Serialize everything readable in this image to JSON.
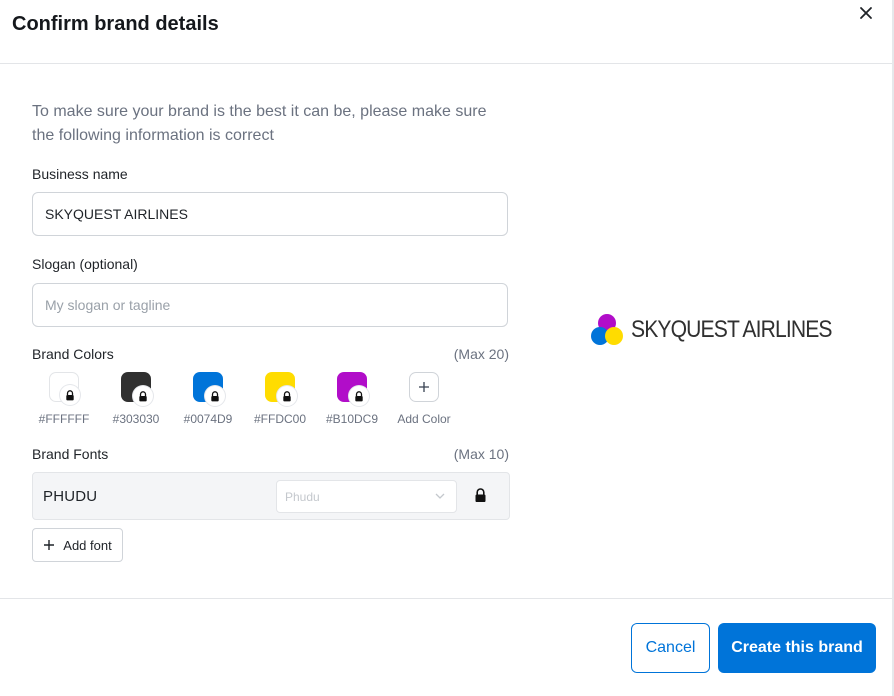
{
  "dialog": {
    "title": "Confirm brand details",
    "intro": "To make sure your brand is the best it can be, please make sure the following information is correct"
  },
  "business": {
    "label": "Business name",
    "value": "SKYQUEST AIRLINES"
  },
  "slogan": {
    "label": "Slogan (optional)",
    "placeholder": "My slogan or tagline",
    "value": ""
  },
  "colors": {
    "label": "Brand Colors",
    "max": "(Max 20)",
    "swatches": [
      {
        "hex": "#FFFFFF",
        "label": "#FFFFFF"
      },
      {
        "hex": "#303030",
        "label": "#303030"
      },
      {
        "hex": "#0074D9",
        "label": "#0074D9"
      },
      {
        "hex": "#FFDC00",
        "label": "#FFDC00"
      },
      {
        "hex": "#B10DC9",
        "label": "#B10DC9"
      }
    ],
    "add_label": "Add Color"
  },
  "fonts": {
    "label": "Brand Fonts",
    "max": "(Max 10)",
    "items": [
      {
        "name": "PHUDU",
        "select_value": "Phudu"
      }
    ],
    "add_label": "Add font"
  },
  "preview": {
    "brand_name": "SKYQUEST AIRLINES",
    "logo_colors": [
      "#B10DC9",
      "#0074D9",
      "#FFDC00"
    ]
  },
  "footer": {
    "cancel_label": "Cancel",
    "create_label": "Create this brand"
  },
  "theme": {
    "accent": "#0074D9"
  }
}
